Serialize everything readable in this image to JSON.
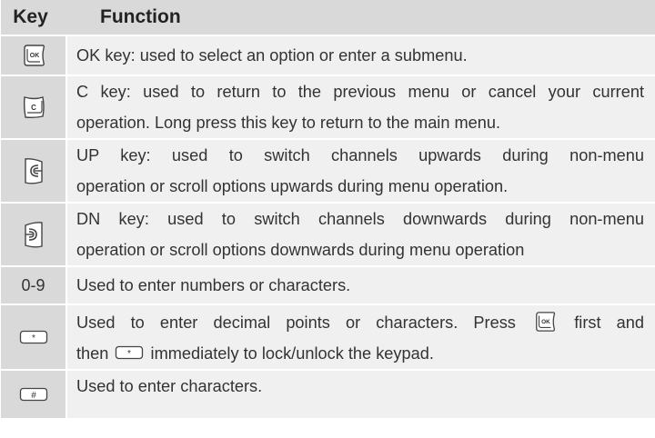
{
  "header": {
    "key": "Key",
    "function": "Function"
  },
  "rows": [
    {
      "icon": "ok-key-icon",
      "lines": [
        "OK key: used to select an option or enter a submenu."
      ]
    },
    {
      "icon": "c-key-icon",
      "lines": [
        "C key: used to return to the previous menu or cancel your current",
        "operation. Long press this key to return to the main menu."
      ]
    },
    {
      "icon": "up-key-icon",
      "lines": [
        "UP key: used to switch channels upwards during non-menu",
        "operation or scroll options upwards during menu operation."
      ]
    },
    {
      "icon": "down-key-icon",
      "lines": [
        "DN key: used to switch channels downwards during non-menu",
        "operation or scroll options downwards during menu operation"
      ]
    },
    {
      "key_text": "0-9",
      "lines": [
        "Used to enter numbers or characters."
      ]
    },
    {
      "icon": "star-key-icon",
      "line1_a": "Used to enter decimal points or characters. Press",
      "line1_b": "first and",
      "line2_a": "then",
      "line2_b": "immediately to lock/unlock the keypad."
    },
    {
      "icon": "hash-key-icon",
      "lines": [
        "Used to enter characters."
      ]
    }
  ],
  "icon_labels": {
    "ok": "OK",
    "c": "C",
    "star": "*",
    "hash": "#"
  }
}
